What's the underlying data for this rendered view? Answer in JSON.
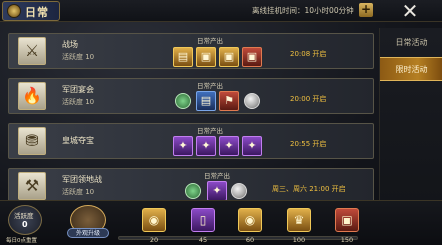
{
  "header": {
    "title": "日常",
    "offline_time": "离线挂机时间：10小时00分钟",
    "plus_label": "+",
    "close_label": "✕"
  },
  "tabs": [
    {
      "label": "日常活动",
      "selected": false
    },
    {
      "label": "限时活动",
      "selected": true
    }
  ],
  "rows": [
    {
      "name": "战场",
      "activity": "活跃度 10",
      "output_label": "日常产出",
      "time": "20:08 开启",
      "icon": "battlefield-icon",
      "rewards": [
        "gold-scroll",
        "gold-chest",
        "gold-chest",
        "red-chest"
      ]
    },
    {
      "name": "军团宴会",
      "activity": "活跃度 10",
      "output_label": "日常产出",
      "time": "20:00 开启",
      "icon": "banquet-fire-icon",
      "rewards": [
        "green-seal",
        "blue-scroll",
        "red-banner",
        "silver-coin"
      ]
    },
    {
      "name": "皇城夺宝",
      "activity": "",
      "output_label": "日常产出",
      "time": "20:55 开启",
      "icon": "treasure-chest-icon",
      "rewards": [
        "purple-shard",
        "purple-shard",
        "purple-shard",
        "purple-shard"
      ]
    },
    {
      "name": "军团领地战",
      "activity": "活跃度 10",
      "output_label": "日常产出",
      "time": "周三、周六 21:00 开启",
      "icon": "crossed-axes-icon",
      "rewards": [
        "green-seal",
        "purple-shard",
        "silver-coin"
      ]
    }
  ],
  "bottom": {
    "activity_label": "活跃度",
    "activity_value": "0",
    "reset_text": "每日0点重置",
    "upgrade_label": "外观升级",
    "progress": 0,
    "milestones": [
      {
        "value": "20",
        "reward": "gold-coin"
      },
      {
        "value": "45",
        "reward": "purple-card"
      },
      {
        "value": "60",
        "reward": "gold-coin"
      },
      {
        "value": "100",
        "reward": "gold-trophy"
      },
      {
        "value": "150",
        "reward": "red-chest"
      }
    ]
  },
  "colors": {
    "accent_gold": "#f0c040",
    "tab_active": "#b57f22"
  }
}
